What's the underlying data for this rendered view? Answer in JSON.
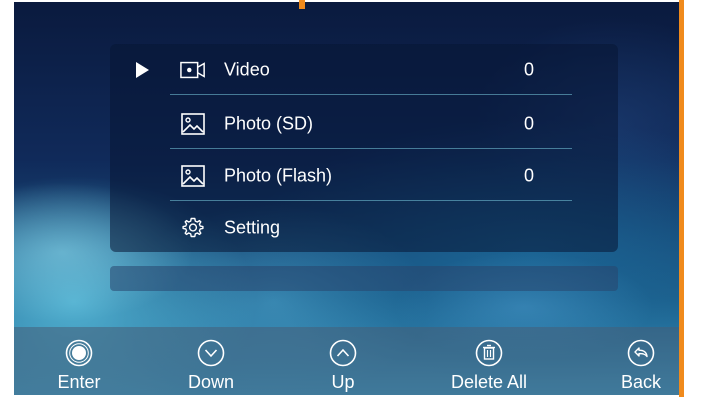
{
  "menu": {
    "selected_index": 0,
    "items": [
      {
        "label": "Video",
        "count": "0",
        "icon": "video-camera-icon"
      },
      {
        "label": "Photo (SD)",
        "count": "0",
        "icon": "image-icon"
      },
      {
        "label": "Photo (Flash)",
        "count": "0",
        "icon": "image-icon"
      },
      {
        "label": "Setting",
        "count": "",
        "icon": "gear-icon"
      }
    ]
  },
  "soft_buttons": [
    {
      "label": "Enter",
      "icon": "enter-circle-icon"
    },
    {
      "label": "Down",
      "icon": "chevron-down-circle-icon"
    },
    {
      "label": "Up",
      "icon": "chevron-up-circle-icon"
    },
    {
      "label": "Delete All",
      "icon": "trash-circle-icon"
    },
    {
      "label": "Back",
      "icon": "back-arrow-circle-icon"
    }
  ],
  "colors": {
    "accent_orange": "#f08a1c",
    "text": "#ffffff",
    "separator": "#78c8dc"
  }
}
